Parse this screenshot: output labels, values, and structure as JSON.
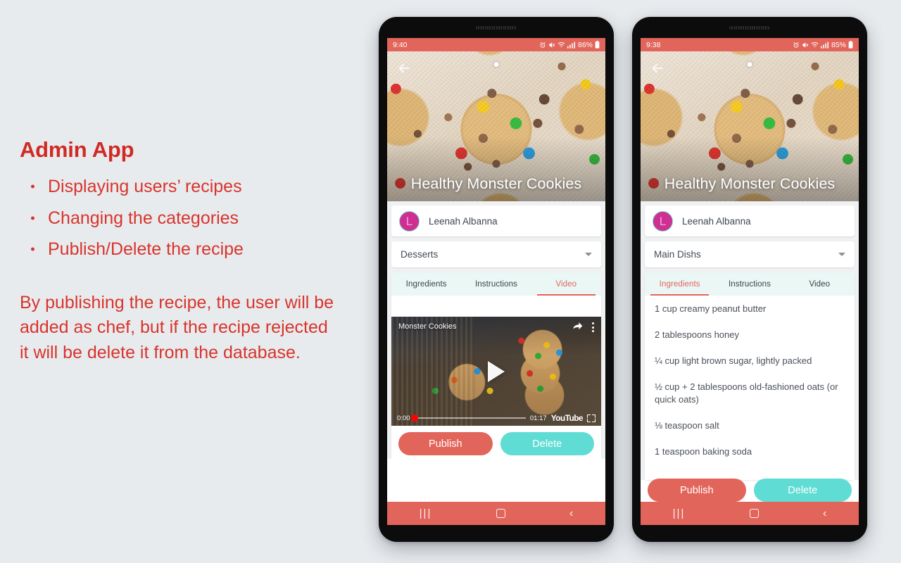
{
  "slide": {
    "title": "Admin App",
    "bullets": [
      "Displaying users’ recipes",
      "Changing the categories",
      "Publish/Delete the recipe"
    ],
    "paragraph": "By publishing the recipe, the user will be added as chef, but if the recipe rejected it will be delete it from the database.",
    "accent_color": "#d8342c",
    "background_color": "#e8ebee"
  },
  "theme": {
    "primary": "#e2655b",
    "secondary": "#5fdcd3",
    "tabbar_background": "#eaf7f5",
    "avatar_background": "#cd2f92"
  },
  "phone_left": {
    "status": {
      "time": "9:40",
      "battery": "86%",
      "icons": [
        "alarm-icon",
        "mute-icon",
        "wifi-icon",
        "signal-icon",
        "battery-icon"
      ]
    },
    "hero": {
      "title": "Healthy Monster Cookies",
      "back": "back-arrow-icon",
      "dot": "page-indicator-dot"
    },
    "chef": {
      "avatar_letter": "L",
      "name": "Leenah Albanna"
    },
    "category": {
      "value": "Desserts",
      "caret": "chevron-down-icon"
    },
    "tabs": [
      {
        "label": "Ingredients",
        "active": false
      },
      {
        "label": "Instructions",
        "active": false
      },
      {
        "label": "Video",
        "active": true
      }
    ],
    "video": {
      "title": "Monster Cookies",
      "current_time": "0:00",
      "duration": "01:17",
      "brand": "YouTube",
      "share": "share-icon",
      "menu": "kebab-menu-icon",
      "play": "play-icon",
      "fullscreen": "fullscreen-icon"
    },
    "actions": {
      "publish": "Publish",
      "delete": "Delete"
    },
    "navbar": {
      "recents": "|||",
      "home": "home-icon",
      "back": "‹"
    }
  },
  "phone_right": {
    "status": {
      "time": "9:38",
      "battery": "85%",
      "icons": [
        "alarm-icon",
        "mute-icon",
        "wifi-icon",
        "signal-icon",
        "battery-icon"
      ]
    },
    "hero": {
      "title": "Healthy Monster Cookies",
      "back": "back-arrow-icon",
      "dot": "page-indicator-dot"
    },
    "chef": {
      "avatar_letter": "L",
      "name": "Leenah Albanna"
    },
    "category": {
      "value": "Main Dishs",
      "caret": "chevron-down-icon"
    },
    "tabs": [
      {
        "label": "Ingredients",
        "active": true
      },
      {
        "label": "Instructions",
        "active": false
      },
      {
        "label": "Video",
        "active": false
      }
    ],
    "ingredients": [
      "1 cup creamy peanut butter",
      "2 tablespoons honey",
      "¼ cup light brown sugar, lightly packed",
      "½ cup + 2 tablespoons old-fashioned oats (or quick oats)",
      "⅛ teaspoon salt",
      "1 teaspoon baking soda"
    ],
    "actions": {
      "publish": "Publish",
      "delete": "Delete"
    },
    "navbar": {
      "recents": "|||",
      "home": "home-icon",
      "back": "‹"
    }
  }
}
